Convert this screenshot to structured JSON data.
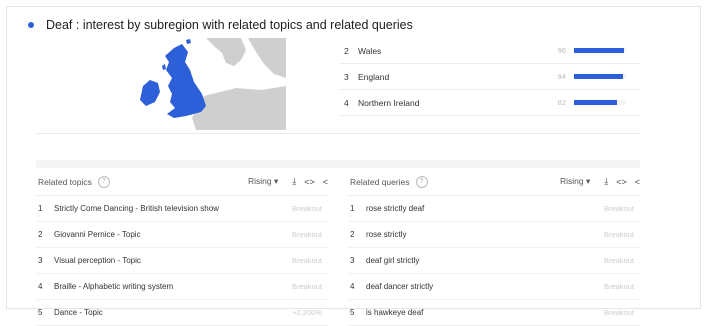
{
  "header": {
    "title": "Deaf : interest by subregion with related topics and related queries"
  },
  "regions": [
    {
      "rank": "2",
      "name": "Wales",
      "score": "96",
      "value": 96
    },
    {
      "rank": "3",
      "name": "England",
      "score": "94",
      "value": 94
    },
    {
      "rank": "4",
      "name": "Northern Ireland",
      "score": "82",
      "value": 82
    }
  ],
  "related_topics": {
    "title": "Related topics",
    "filter": "Rising",
    "rows": [
      {
        "rank": "1",
        "label": "Strictly Come Dancing - British television show",
        "value": "Breakout"
      },
      {
        "rank": "2",
        "label": "Giovanni Pernice - Topic",
        "value": "Breakout"
      },
      {
        "rank": "3",
        "label": "Visual perception - Topic",
        "value": "Breakout"
      },
      {
        "rank": "4",
        "label": "Braille - Alphabetic writing system",
        "value": "Breakout"
      },
      {
        "rank": "5",
        "label": "Dance - Topic",
        "value": "+2,200%"
      }
    ]
  },
  "related_queries": {
    "title": "Related queries",
    "filter": "Rising",
    "rows": [
      {
        "rank": "1",
        "label": "rose strictly deaf",
        "value": "Breakout"
      },
      {
        "rank": "2",
        "label": "rose strictly",
        "value": "Breakout"
      },
      {
        "rank": "3",
        "label": "deaf girl strictly",
        "value": "Breakout"
      },
      {
        "rank": "4",
        "label": "deaf dancer strictly",
        "value": "Breakout"
      },
      {
        "rank": "5",
        "label": "is hawkeye deaf",
        "value": "Breakout"
      }
    ]
  },
  "icons": {
    "help": "?",
    "dropdown": "▾",
    "download": "⤓",
    "embed": "<>",
    "share": "<"
  },
  "colors": {
    "accent": "#2c5fd8"
  }
}
